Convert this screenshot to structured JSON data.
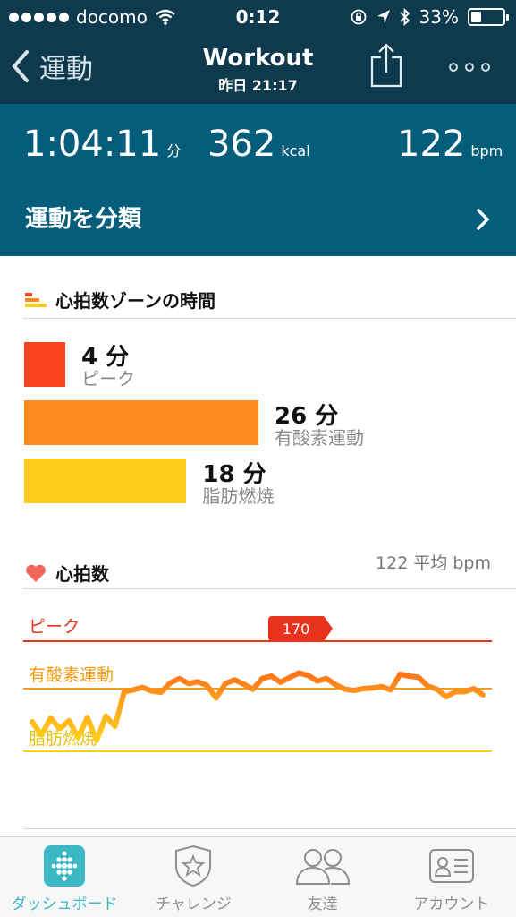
{
  "status_bar": {
    "carrier": "docomo",
    "time": "0:12",
    "battery": "33%",
    "battery_level": 0.33
  },
  "nav": {
    "back_label": "運動",
    "title": "Workout",
    "subtitle": "昨日 21:17"
  },
  "stats": {
    "duration": {
      "value": "1:04:11",
      "unit": "分"
    },
    "calories": {
      "value": "362",
      "unit": "kcal"
    },
    "heart_rate": {
      "value": "122",
      "unit": "bpm"
    },
    "classify_label": "運動を分類"
  },
  "zones": {
    "title": "心拍数ゾーンの時間",
    "items": [
      {
        "value": "4 分",
        "label": "ピーク",
        "minutes": 4,
        "color": "#fb4420"
      },
      {
        "value": "26 分",
        "label": "有酸素運動",
        "minutes": 26,
        "color": "#fd8a1c"
      },
      {
        "value": "18 分",
        "label": "脂肪燃焼",
        "minutes": 18,
        "color": "#fecb1c"
      }
    ]
  },
  "heart_rate": {
    "title": "心拍数",
    "average": "122 平均 bpm",
    "peak_label": "ピーク",
    "cardio_label": "有酸素運動",
    "fatburn_label": "脂肪燃焼",
    "max_badge": "170"
  },
  "chart_data": {
    "type": "line",
    "title": "心拍数",
    "peak_value": 170,
    "thresholds": [
      {
        "name": "ピーク",
        "color": "#e8321c"
      },
      {
        "name": "有酸素運動",
        "color": "#f59a12"
      },
      {
        "name": "脂肪燃焼",
        "color": "#f5cf10"
      }
    ],
    "y_relative": [
      0.47,
      0.26,
      0.53,
      0.36,
      0.49,
      0.22,
      0.54,
      0.17,
      0.56,
      0.4,
      0.95,
      0.98,
      1.02,
      0.96,
      0.94,
      1.09,
      1.16,
      1.08,
      1.11,
      1.05,
      0.85,
      1.08,
      1.14,
      1.07,
      0.99,
      1.16,
      1.2,
      1.1,
      1.18,
      1.25,
      1.21,
      1.12,
      1.16,
      1.06,
      0.99,
      0.97,
      1.0,
      1.01,
      1.03,
      0.98,
      1.23,
      1.2,
      1.18,
      1.04,
      0.99,
      0.87,
      0.95,
      0.95,
      1.0,
      0.9
    ]
  },
  "tabs": [
    {
      "label": "ダッシュボード",
      "active": true
    },
    {
      "label": "チャレンジ",
      "active": false
    },
    {
      "label": "友達",
      "active": false
    },
    {
      "label": "アカウント",
      "active": false
    }
  ],
  "colors": {
    "header": "#0f3a4d",
    "stats": "#055d7c",
    "accent": "#3bb8c4"
  }
}
